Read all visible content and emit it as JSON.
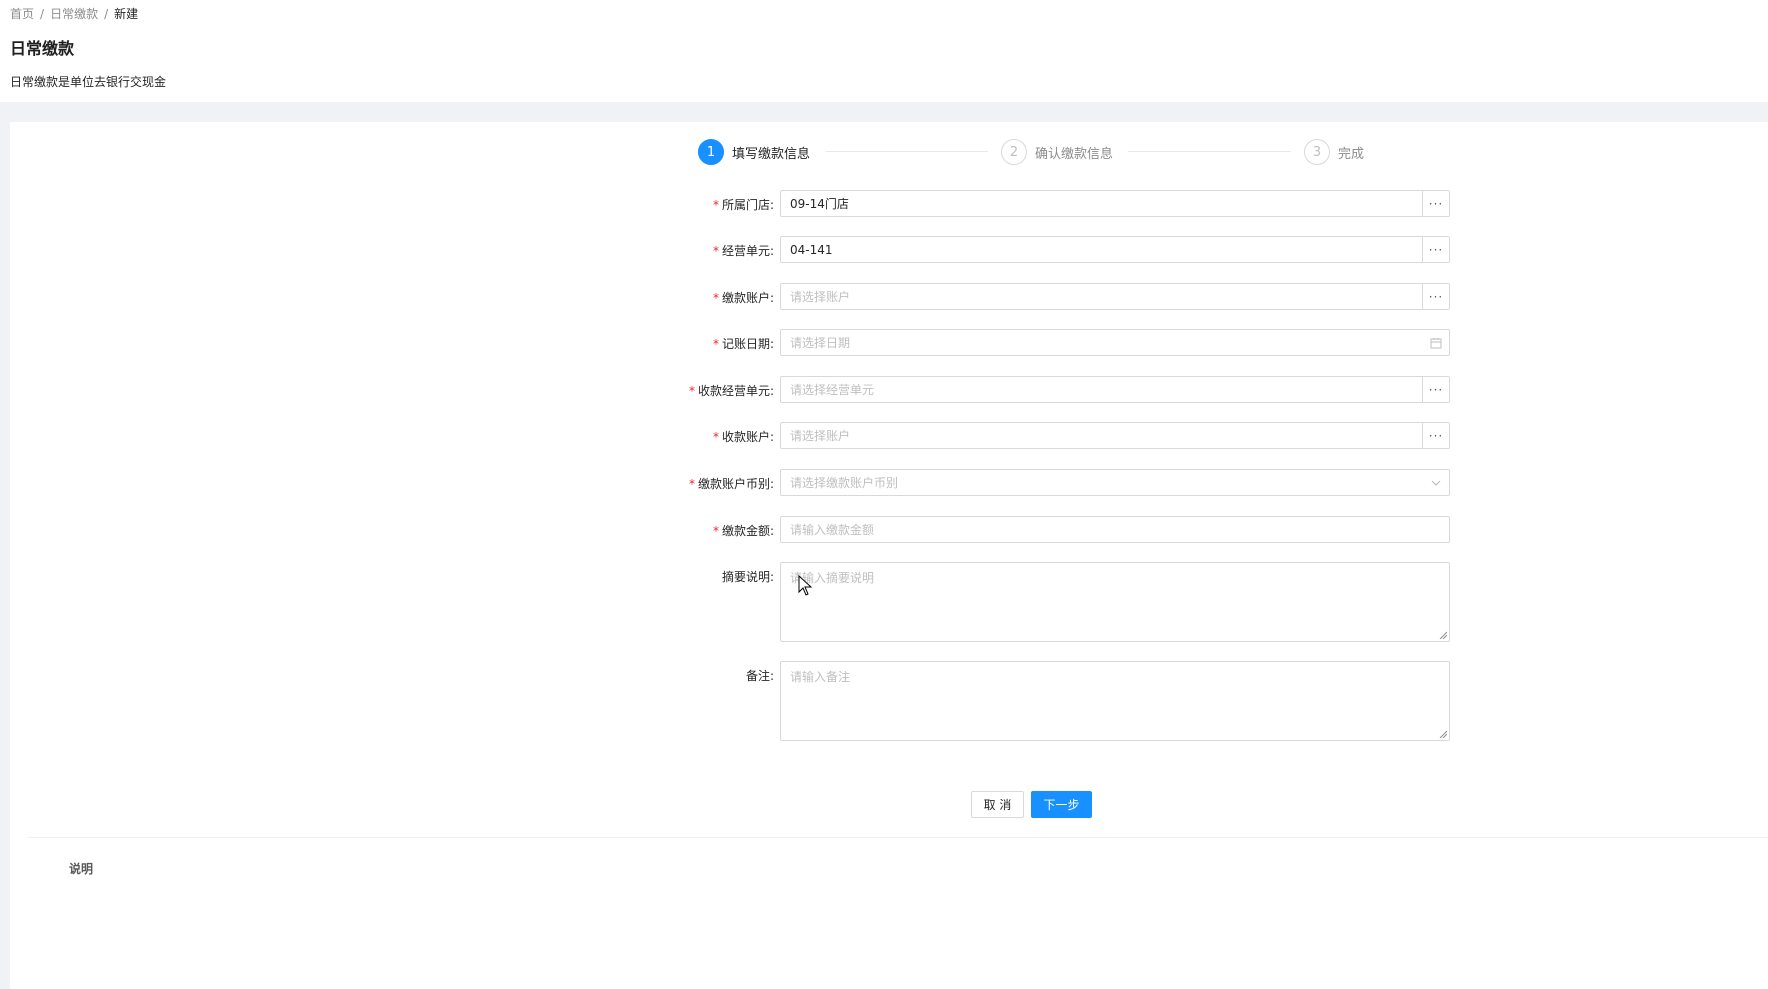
{
  "breadcrumb": {
    "items": [
      "首页",
      "日常缴款"
    ],
    "current": "新建",
    "separator": "/"
  },
  "page": {
    "title": "日常缴款",
    "description": "日常缴款是单位去银行交现金"
  },
  "steps": [
    {
      "number": "1",
      "label": "填写缴款信息",
      "status": "active"
    },
    {
      "number": "2",
      "label": "确认缴款信息",
      "status": "wait"
    },
    {
      "number": "3",
      "label": "完成",
      "status": "wait"
    }
  ],
  "form": {
    "required_mark": "*",
    "store": {
      "label": "所属门店:",
      "value": "09-14门店",
      "addon": "···"
    },
    "business_unit": {
      "label": "经营单元:",
      "value": "04-141",
      "addon": "···"
    },
    "payment_account": {
      "label": "缴款账户:",
      "placeholder": "请选择账户",
      "addon": "···"
    },
    "posting_date": {
      "label": "记账日期:",
      "placeholder": "请选择日期",
      "icon": "calendar-icon"
    },
    "receiving_unit": {
      "label": "收款经营单元:",
      "placeholder": "请选择经营单元",
      "addon": "···"
    },
    "receiving_account": {
      "label": "收款账户:",
      "placeholder": "请选择账户",
      "addon": "···"
    },
    "currency": {
      "label": "缴款账户币别:",
      "placeholder": "请选择缴款账户币别",
      "icon": "chevron-down-icon"
    },
    "amount": {
      "label": "缴款金额:",
      "placeholder": "请输入缴款金额"
    },
    "summary": {
      "label": "摘要说明:",
      "placeholder": "请输入摘要说明"
    },
    "remark": {
      "label": "备注:",
      "placeholder": "请输入备注"
    }
  },
  "buttons": {
    "cancel": "取 消",
    "next": "下一步"
  },
  "section": {
    "title": "说明"
  },
  "colors": {
    "primary": "#1890ff",
    "required": "#f5222d",
    "background": "#f0f2f5",
    "border": "#d9d9d9",
    "placeholder": "#bfbfbf"
  }
}
